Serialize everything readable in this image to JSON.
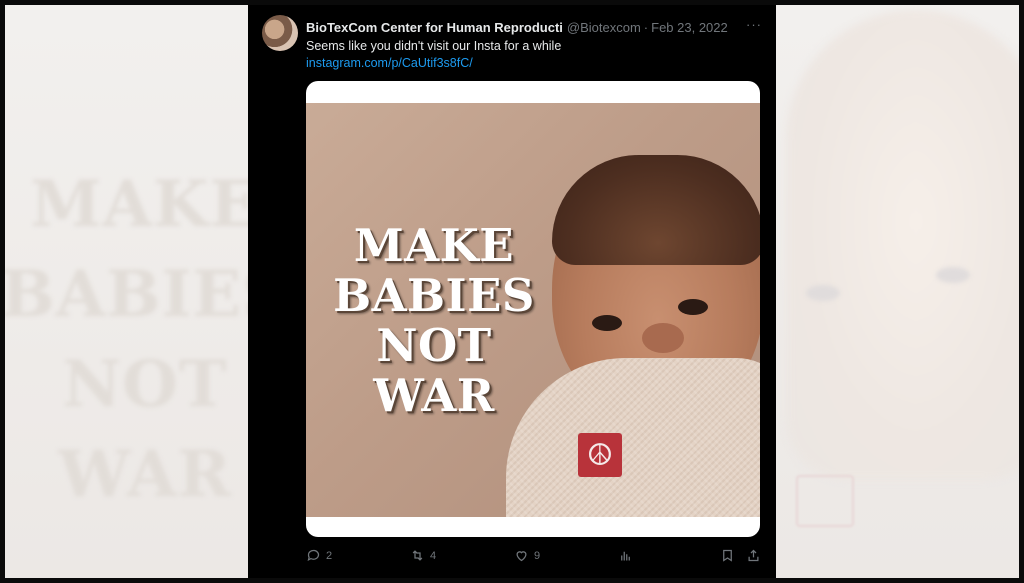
{
  "background_text": [
    "MAKE",
    "BABIES",
    "NOT",
    "WAR"
  ],
  "tweet": {
    "author_name": "BioTexCom Center for Human Reproducti",
    "handle": "@Biotexcom",
    "separator": "·",
    "date": "Feb 23, 2022",
    "more": "···",
    "text": "Seems like you didn't visit our Insta for a while",
    "link": "instagram.com/p/CaUtif3s8fC/"
  },
  "media": {
    "slogan_lines": [
      "MAKE",
      "BABIES",
      "NOT",
      "WAR"
    ],
    "badge_symbol": "☮"
  },
  "actions": {
    "replies": "2",
    "reposts": "4",
    "likes": "9"
  },
  "colors": {
    "link": "#1d9bf0",
    "muted": "#71767b",
    "badge": "#b8333a"
  },
  "icons": [
    "reply-icon",
    "repost-icon",
    "like-icon",
    "views-icon",
    "bookmark-icon",
    "share-icon",
    "more-icon",
    "peace-icon"
  ]
}
